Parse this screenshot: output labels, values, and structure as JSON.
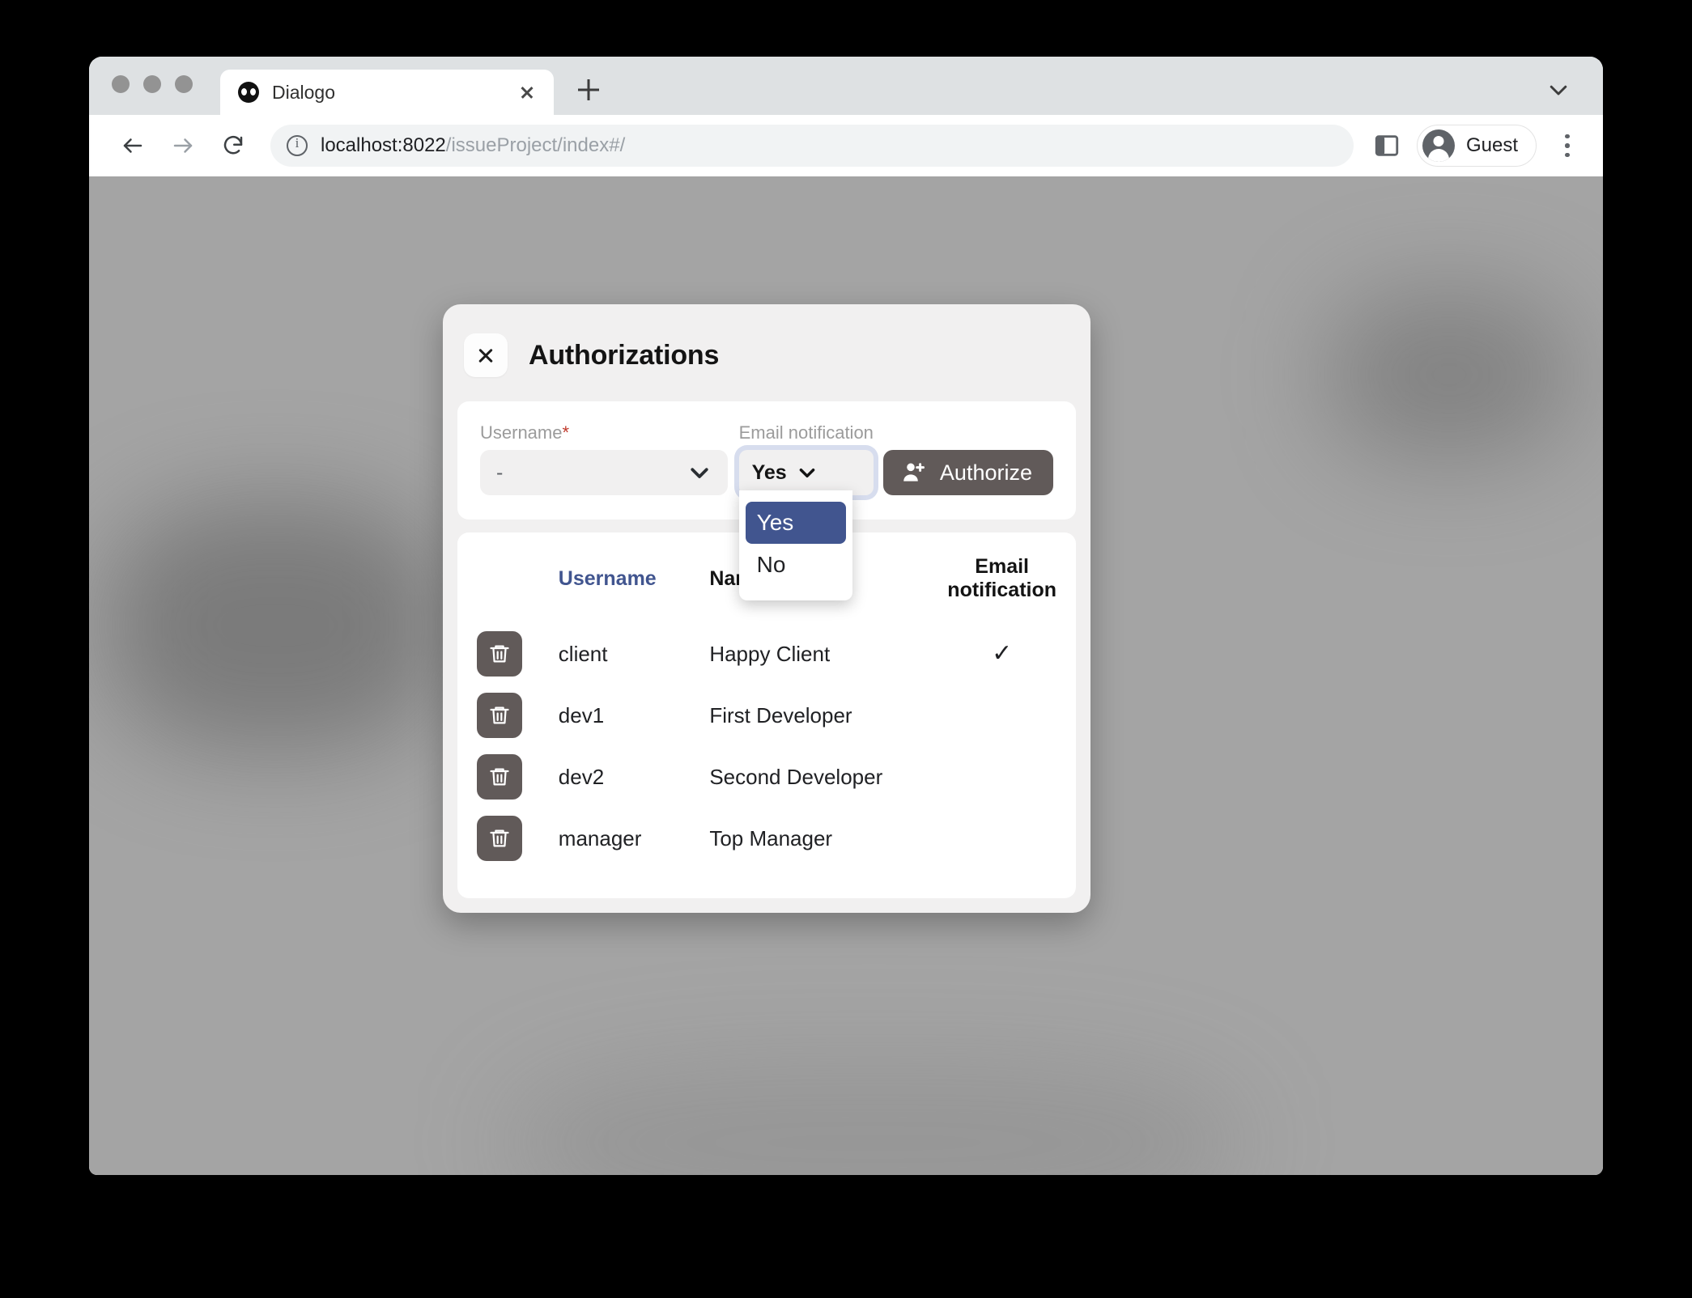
{
  "browser": {
    "tab": {
      "title": "Dialogo",
      "favicon": "dialogo-favicon",
      "close_icon": "close-icon"
    },
    "new_tab_icon": "plus-icon",
    "tabstrip_chevron_icon": "chevron-down-icon",
    "nav": {
      "back_icon": "arrow-left-icon",
      "forward_icon": "arrow-right-icon",
      "reload_icon": "reload-icon"
    },
    "omnibox": {
      "info_icon": "info-circle-icon",
      "url_host": "localhost:8022",
      "url_path": "/issueProject/index#/",
      "url_full": "localhost:8022/issueProject/index#/"
    },
    "sidepanel_icon": "side-panel-icon",
    "profile": {
      "label": "Guest",
      "avatar_icon": "person-avatar-icon"
    },
    "menu_icon": "three-dots-vertical-icon"
  },
  "dialog": {
    "title": "Authorizations",
    "close_icon": "close-icon",
    "form": {
      "username": {
        "label": "Username",
        "required_marker": "*",
        "value": "-",
        "chevron_icon": "chevron-down-icon"
      },
      "email_notification": {
        "label": "Email notification",
        "value": "Yes",
        "chevron_icon": "chevron-down-icon",
        "options": [
          "Yes",
          "No"
        ],
        "selected_option": "Yes"
      },
      "authorize": {
        "label": "Authorize",
        "icon": "person-add-icon"
      }
    },
    "table": {
      "headers": {
        "action": "",
        "username": "Username",
        "name": "Name",
        "email_notification": "Email notification"
      },
      "sorted_column": "username",
      "rows": [
        {
          "delete_icon": "trash-icon",
          "username": "client",
          "name": "Happy Client",
          "email_notification": "✓"
        },
        {
          "delete_icon": "trash-icon",
          "username": "dev1",
          "name": "First Developer",
          "email_notification": ""
        },
        {
          "delete_icon": "trash-icon",
          "username": "dev2",
          "name": "Second Developer",
          "email_notification": ""
        },
        {
          "delete_icon": "trash-icon",
          "username": "manager",
          "name": "Top Manager",
          "email_notification": ""
        }
      ]
    }
  },
  "colors": {
    "accent_blue": "#41558f",
    "button_dark": "#615a59",
    "dialog_bg": "#f1f0f0",
    "required_red": "#c0392b",
    "focus_ring": "#d7ddee"
  }
}
